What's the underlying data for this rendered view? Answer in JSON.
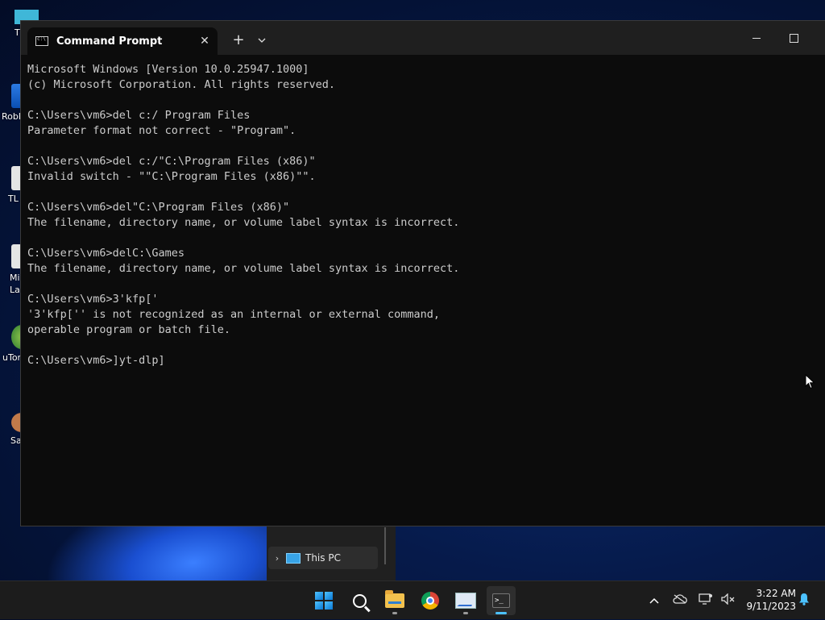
{
  "desktop": {
    "icons": [
      {
        "label": "T"
      },
      {
        "label": "Robl"
      },
      {
        "label": "TL"
      },
      {
        "label": "Mi La"
      },
      {
        "label": "uTor"
      },
      {
        "label": "Sa"
      }
    ]
  },
  "explorer": {
    "nav_item": "This PC"
  },
  "terminal": {
    "tab_title": "Command Prompt",
    "tab_close": "✕",
    "new_tab": "+",
    "dropdown": "⌄",
    "lines": [
      "Microsoft Windows [Version 10.0.25947.1000]",
      "(c) Microsoft Corporation. All rights reserved.",
      "",
      "C:\\Users\\vm6>del c:/ Program Files",
      "Parameter format not correct - \"Program\".",
      "",
      "C:\\Users\\vm6>del c:/\"C:\\Program Files (x86)\"",
      "Invalid switch - \"\"C:\\Program Files (x86)\"\".",
      "",
      "C:\\Users\\vm6>del\"C:\\Program Files (x86)\"",
      "The filename, directory name, or volume label syntax is incorrect.",
      "",
      "C:\\Users\\vm6>delC:\\Games",
      "The filename, directory name, or volume label syntax is incorrect.",
      "",
      "C:\\Users\\vm6>3'kfp['",
      "'3'kfp['' is not recognized as an internal or external command,",
      "operable program or batch file.",
      "",
      "C:\\Users\\vm6>]yt-dlp]"
    ]
  },
  "taskbar": {
    "apps": [
      "start-icon",
      "search-icon",
      "file-explorer-icon",
      "chrome-icon",
      "task-manager-icon",
      "terminal-icon"
    ],
    "clock_time": "3:22 AM",
    "clock_date": "9/11/2023"
  },
  "colors": {
    "console_bg": "#0c0c0c",
    "console_fg": "#cccccc",
    "titlebar_bg": "#1f1f1f",
    "taskbar_bg": "#1c1c1c",
    "accent": "#4cc2ff"
  }
}
